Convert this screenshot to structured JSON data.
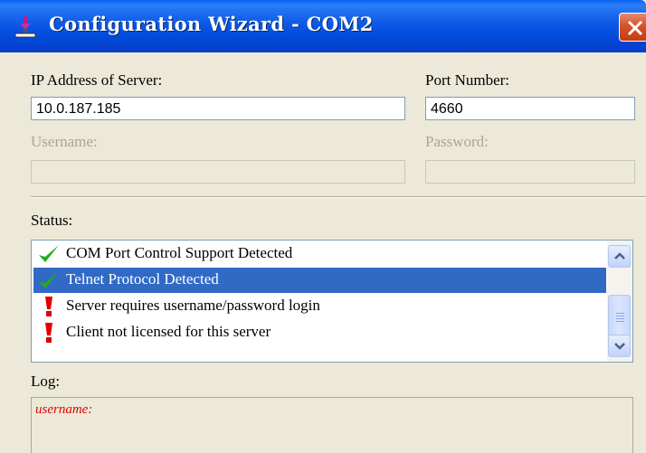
{
  "window": {
    "title": "Configuration Wizard - COM2",
    "app_icon": "port-plug-icon",
    "close_icon": "close-icon"
  },
  "server": {
    "ip_label": "IP Address of Server:",
    "ip_value": "10.0.187.185",
    "port_label": "Port Number:",
    "port_value": "4660",
    "username_label": "Username:",
    "username_value": "",
    "password_label": "Password:",
    "password_value": ""
  },
  "status": {
    "label": "Status:",
    "items": [
      {
        "text": "COM Port Control Support Detected",
        "icon": "checkmark-icon",
        "selected": false
      },
      {
        "text": "Telnet Protocol Detected",
        "icon": "checkmark-icon",
        "selected": true
      },
      {
        "text": "Server requires username/password login",
        "icon": "exclamation-icon",
        "selected": false
      },
      {
        "text": "Client not licensed for this server",
        "icon": "exclamation-icon",
        "selected": false
      }
    ]
  },
  "log": {
    "label": "Log:",
    "text": "username:"
  },
  "colors": {
    "titlebar": "#0a58e6",
    "selection": "#316ac5",
    "check": "#22aa22",
    "error": "#e00000",
    "dialog_bg": "#ece9d8"
  }
}
